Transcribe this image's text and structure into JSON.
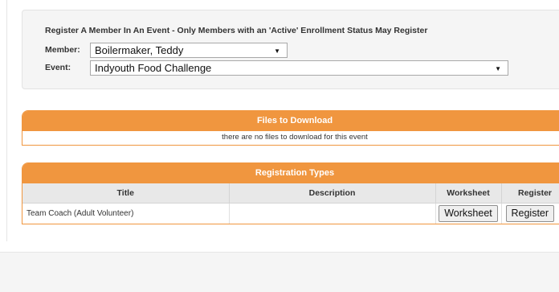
{
  "register": {
    "title": "Register A Member In An Event - Only Members with an 'Active' Enrollment Status May Register",
    "member_label": "Member:",
    "member_value": "Boilermaker, Teddy",
    "event_label": "Event:",
    "event_value": "Indyouth Food Challenge"
  },
  "files": {
    "header": "Files to Download",
    "empty_message": "there are no files to download for this event"
  },
  "registration": {
    "header": "Registration Types",
    "columns": [
      "Title",
      "Description",
      "Worksheet",
      "Register"
    ],
    "rows": [
      {
        "title": "Team Coach (Adult Volunteer)",
        "description": "",
        "worksheet_button": "Worksheet",
        "register_button": "Register"
      }
    ]
  },
  "colors": {
    "panel_header": "#f0963f",
    "well_background": "#f5f5f5"
  },
  "icons": {
    "select_arrow": "triangle-down"
  }
}
